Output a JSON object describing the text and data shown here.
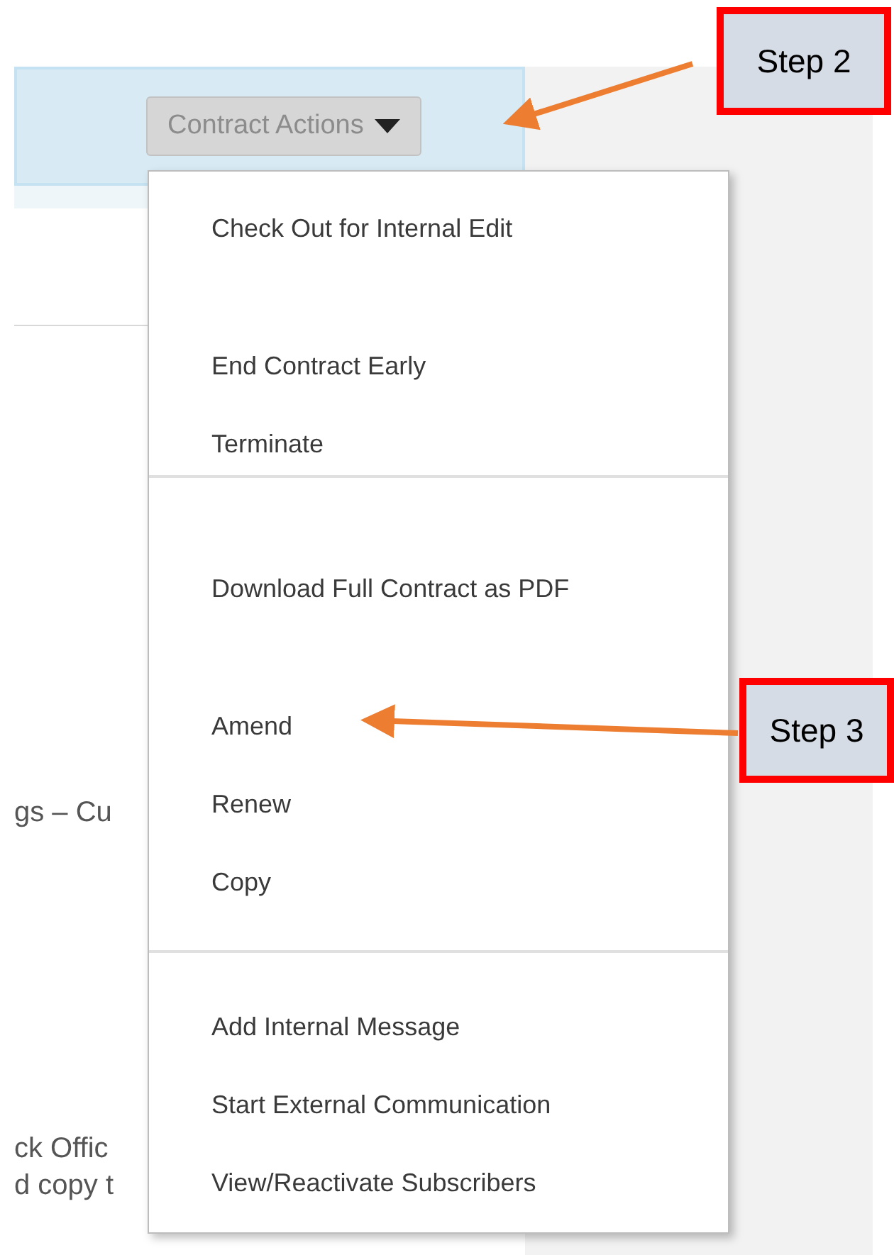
{
  "header": {
    "button": {
      "label": "Contract Actions",
      "expanded": true
    }
  },
  "menu": {
    "sections": [
      {
        "items": [
          "Check Out for Internal Edit",
          "End Contract Early",
          "Terminate"
        ]
      },
      {
        "items": [
          "Download Full Contract as PDF",
          "Amend",
          "Renew",
          "Copy"
        ]
      },
      {
        "items": [
          "Add Internal Message",
          "Start External Communication",
          "View/Reactivate Subscribers"
        ]
      }
    ]
  },
  "background_text": [
    "gs – Cu",
    "ck Offic",
    "d copy t"
  ],
  "callouts": [
    {
      "label": "Step 2"
    },
    {
      "label": "Step 3"
    }
  ]
}
